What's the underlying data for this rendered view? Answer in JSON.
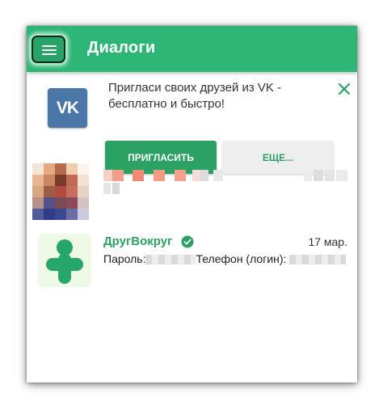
{
  "toolbar": {
    "title": "Диалоги",
    "menu_icon": "hamburger-menu-icon",
    "color": "#2eb676"
  },
  "invite_banner": {
    "logo_text": "VK",
    "message": "Пригласи своих друзей из VK - бесплатно и быстро!",
    "invite_label": "ПРИГЛАСИТЬ",
    "more_label": "ЕЩЕ...",
    "close_icon": "close-icon",
    "accent": "#2ba263"
  },
  "dialogs": [
    {
      "name": "",
      "date": "",
      "preview": "",
      "avatar": "pixelated-photo"
    },
    {
      "name": "ДругВокруг",
      "verified_icon": "verified-check-icon",
      "date": "17 мар.",
      "preview_label_password": "Пароль:",
      "preview_label_phone": "Телефон (логин):",
      "avatar": "drugvokrug-logo"
    }
  ]
}
